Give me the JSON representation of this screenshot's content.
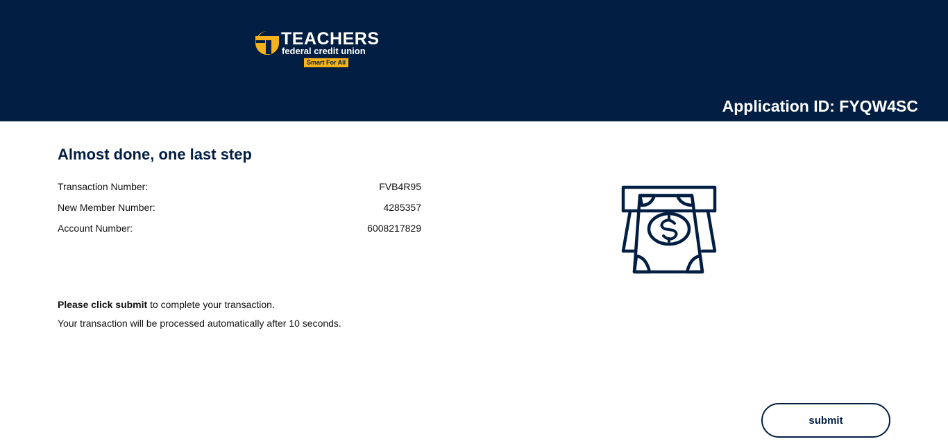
{
  "header": {
    "logo": {
      "name": "TEACHERS",
      "subtitle": "federal credit union",
      "tagline": "Smart For All"
    },
    "application_id": "Application ID: FYQW4SC"
  },
  "main": {
    "title": "Almost done, one last step",
    "details": [
      {
        "label": "Transaction Number:",
        "value": "FVB4R95"
      },
      {
        "label": "New Member Number:",
        "value": "4285357"
      },
      {
        "label": "Account Number:",
        "value": "6008217829"
      }
    ],
    "instruction_bold": "Please click submit",
    "instruction_rest": " to complete your transaction.",
    "auto_note": "Your transaction will be processed automatically after 10 seconds.",
    "illustration_icon": "cash-withdrawal-icon"
  },
  "actions": {
    "submit_label": "submit"
  },
  "colors": {
    "brand_navy": "#021e42",
    "brand_gold": "#f5b21b"
  }
}
